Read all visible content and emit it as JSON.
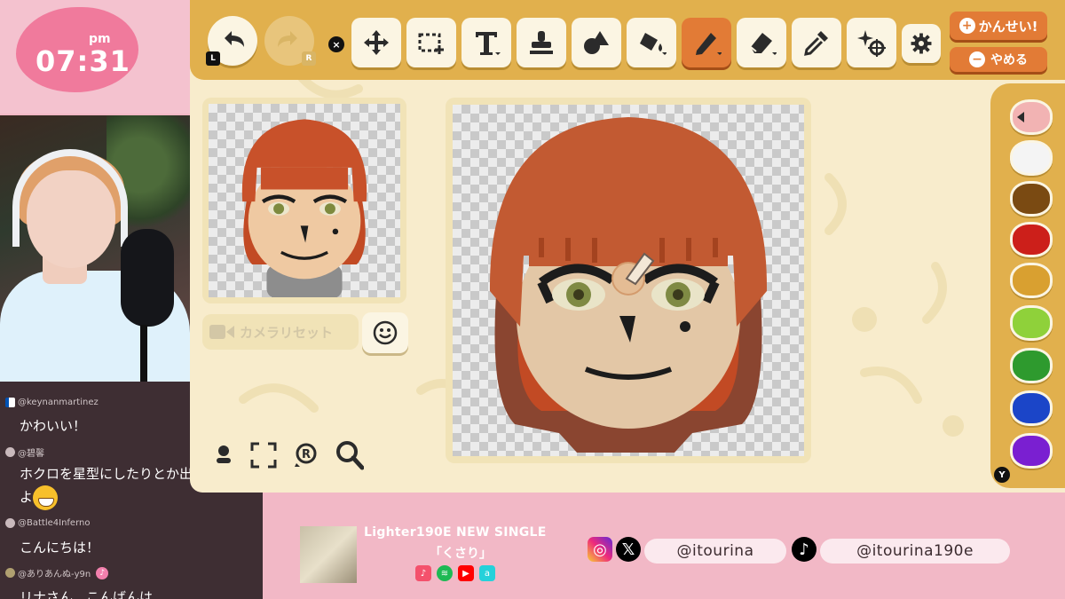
{
  "clock": {
    "ampm": "pm",
    "time": "07:31"
  },
  "chat": {
    "messages": [
      {
        "user": "@keynanmartinez",
        "text": "かわいい！"
      },
      {
        "user": "@碧馨",
        "text": "ホクロを星型にしたりとか出来ます",
        "text2": "よ"
      },
      {
        "user": "@Battle4Inferno",
        "text": "こんにちは！"
      },
      {
        "user": "@ありあんぬ-y9n",
        "text": "リナさん　こんばんは"
      }
    ]
  },
  "toolbar": {
    "undo_key": "L",
    "redo_key": "R",
    "close_key": "×",
    "done_label": "かんせい!",
    "quit_label": "やめる",
    "tools": [
      "move-icon",
      "select-icon",
      "text-icon",
      "stamp-icon",
      "shape-icon",
      "fill-icon",
      "pen-icon",
      "eraser-icon",
      "eyedropper-icon",
      "effects-icon",
      "settings-icon"
    ]
  },
  "preview": {
    "camera_reset_label": "カメラリセット"
  },
  "palette": {
    "selected": "#f2b3b3",
    "colors": [
      "#f2b3b3",
      "#f4f4f4",
      "#7a4a12",
      "#cc1f1a",
      "#d9a030",
      "#8fd13a",
      "#2e9a2e",
      "#1b45c8",
      "#7a1fd1"
    ],
    "y_key": "Y"
  },
  "footer": {
    "single_title": "Lighter190E NEW SINGLE",
    "single_name": "「くさり」",
    "handle_1": "@itourina",
    "handle_2": "@itourina190e"
  }
}
